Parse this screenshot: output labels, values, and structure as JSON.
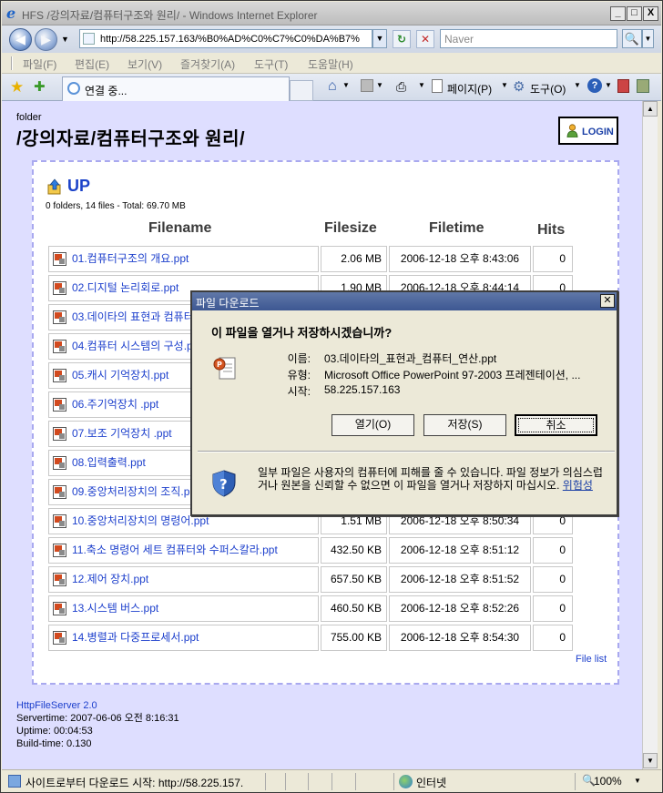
{
  "window": {
    "title": "HFS /강의자료/컴퓨터구조와 원리/ - Windows Internet Explorer",
    "minimize": "_",
    "maximize": "□",
    "close": "X"
  },
  "address": {
    "url": "http://58.225.157.163/%B0%AD%C0%C7%C0%DA%B7%",
    "search_placeholder": "Naver"
  },
  "menu": [
    "파일(F)",
    "편집(E)",
    "보기(V)",
    "즐겨찾기(A)",
    "도구(T)",
    "도움말(H)"
  ],
  "tab": {
    "label": "연결 중..."
  },
  "toolbar": {
    "page": "페이지(P)",
    "tools": "도구(O)"
  },
  "page": {
    "folder_label": "folder",
    "folder_path": "/강의자료/컴퓨터구조와 원리/",
    "login": "LOGIN",
    "up": "UP",
    "summary": "0 folders, 14 files - Total: 69.70 MB",
    "headers": {
      "name": "Filename",
      "size": "Filesize",
      "time": "Filetime",
      "hits": "Hits"
    },
    "files": [
      {
        "name": "01.컴퓨터구조의 개요.ppt",
        "size": "2.06 MB",
        "time": "2006-12-18 오후 8:43:06",
        "hits": "0"
      },
      {
        "name": "02.디지털 논리회로.ppt",
        "size": "1.90 MB",
        "time": "2006-12-18 오후 8:44:14",
        "hits": "0"
      },
      {
        "name": "03.데이타의 표현과 컴퓨터 연산.ppt",
        "size": "",
        "time": "",
        "hits": ""
      },
      {
        "name": "04.컴퓨터 시스템의 구성.ppt",
        "size": "",
        "time": "",
        "hits": ""
      },
      {
        "name": "05.캐시 기억장치.ppt",
        "size": "",
        "time": "",
        "hits": ""
      },
      {
        "name": "06.주기억장치 .ppt",
        "size": "",
        "time": "",
        "hits": ""
      },
      {
        "name": "07.보조 기억장치 .ppt",
        "size": "",
        "time": "",
        "hits": ""
      },
      {
        "name": "08.입력출력.ppt",
        "size": "",
        "time": "",
        "hits": ""
      },
      {
        "name": "09.중앙처리장치의 조직.ppt",
        "size": "",
        "time": "",
        "hits": ""
      },
      {
        "name": "10.중앙처리장치의 명령어.ppt",
        "size": "1.51 MB",
        "time": "2006-12-18 오후 8:50:34",
        "hits": "0"
      },
      {
        "name": "11.축소 명령어 세트 컴퓨터와 수퍼스칼라.ppt",
        "size": "432.50 KB",
        "time": "2006-12-18 오후 8:51:12",
        "hits": "0"
      },
      {
        "name": "12.제어 장치.ppt",
        "size": "657.50 KB",
        "time": "2006-12-18 오후 8:51:52",
        "hits": "0"
      },
      {
        "name": "13.시스템 버스.ppt",
        "size": "460.50 KB",
        "time": "2006-12-18 오후 8:52:26",
        "hits": "0"
      },
      {
        "name": "14.병렬과 다중프로세서.ppt",
        "size": "755.00 KB",
        "time": "2006-12-18 오후 8:54:30",
        "hits": "0"
      }
    ],
    "file_list_link": "File list",
    "footer": {
      "server": "HttpFileServer 2.0",
      "servertime": "Servertime: 2007-06-06 오전 8:16:31",
      "uptime": "Uptime: 00:04:53",
      "buildtime": "Build-time: 0.130"
    }
  },
  "status": {
    "text": "사이트로부터 다운로드 시작: http://58.225.157.",
    "zone": "인터넷",
    "zoom": "100%"
  },
  "dialog": {
    "title": "파일 다운로드",
    "question": "이 파일을 열거나 저장하시겠습니까?",
    "name_label": "이름:",
    "name_value": "03.데이타의_표현과_컴퓨터_연산.ppt",
    "type_label": "유형:",
    "type_value": "Microsoft Office PowerPoint 97-2003 프레젠테이션, ...",
    "from_label": "시작:",
    "from_value": "58.225.157.163",
    "open_button": "열기(O)",
    "save_button": "저장(S)",
    "cancel_button": "취소",
    "warning": "일부 파일은 사용자의 컴퓨터에 피해를 줄 수 있습니다. 파일 정보가 의심스럽거나 원본을 신뢰할 수 없으면 이 파일을 열거나 저장하지 마십시오.",
    "risk_link": "위험성"
  }
}
